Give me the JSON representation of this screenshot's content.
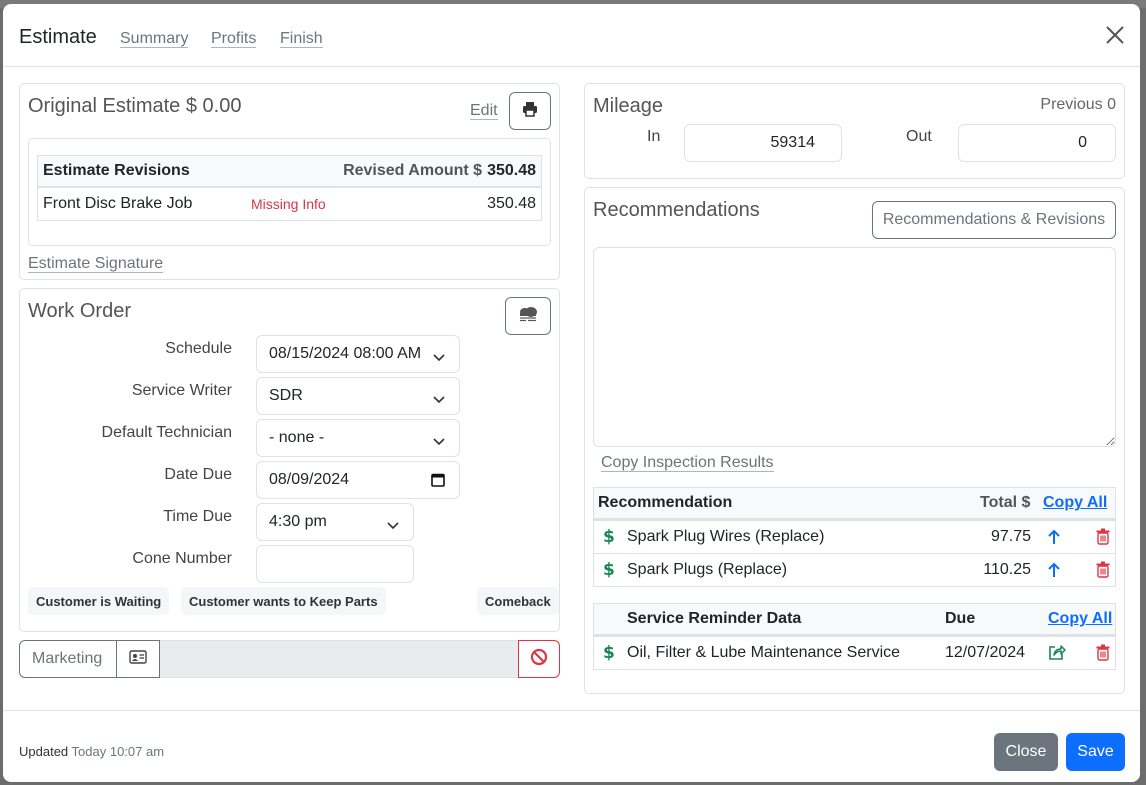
{
  "header": {
    "title": "Estimate",
    "links": [
      "Summary",
      "Profits",
      "Finish"
    ]
  },
  "original_estimate": {
    "title": "Original Estimate $ 0.00",
    "edit_label": "Edit",
    "revisions_header": "Estimate Revisions",
    "revised_amount_label": "Revised Amount $",
    "revised_amount_value": "350.48",
    "rows": [
      {
        "name": "Front Disc Brake Job",
        "status": "Missing Info",
        "amount": "350.48"
      }
    ],
    "signature_link": "Estimate Signature"
  },
  "work_order": {
    "title": "Work Order",
    "fields": {
      "schedule": {
        "label": "Schedule",
        "value": "08/15/2024 08:00 AM"
      },
      "service_writer": {
        "label": "Service Writer",
        "value": "SDR"
      },
      "default_technician": {
        "label": "Default Technician",
        "value": "- none -"
      },
      "date_due": {
        "label": "Date Due",
        "value": "08/09/2024"
      },
      "time_due": {
        "label": "Time Due",
        "value": "4:30 pm"
      },
      "cone_number": {
        "label": "Cone Number",
        "value": ""
      }
    },
    "chips": [
      "Customer is Waiting",
      "Customer wants to Keep Parts",
      "Comeback"
    ]
  },
  "marketing": {
    "label": "Marketing"
  },
  "mileage": {
    "title": "Mileage",
    "previous": "Previous 0",
    "in_label": "In",
    "in_value": "59314",
    "out_label": "Out",
    "out_value": "0"
  },
  "recommendations": {
    "title": "Recommendations",
    "button_label": "Recommendations & Revisions",
    "notes": "",
    "copy_inspection_link": "Copy Inspection Results",
    "table": {
      "headers": {
        "name": "Recommendation",
        "total": "Total $",
        "copy_all": "Copy All"
      },
      "rows": [
        {
          "name": "Spark Plug Wires (Replace)",
          "total": "97.75"
        },
        {
          "name": "Spark Plugs (Replace)",
          "total": "110.25"
        }
      ]
    },
    "reminders": {
      "headers": {
        "name": "Service Reminder Data",
        "due": "Due",
        "copy_all": "Copy All"
      },
      "rows": [
        {
          "name": "Oil, Filter & Lube Maintenance Service",
          "due": "12/07/2024"
        }
      ]
    }
  },
  "footer": {
    "updated_label": "Updated",
    "updated_value": "Today 10:07 am",
    "close_label": "Close",
    "save_label": "Save"
  },
  "colors": {
    "primary": "#0d6efd",
    "secondary": "#6c757d",
    "danger": "#dc3545",
    "success": "#198754"
  }
}
